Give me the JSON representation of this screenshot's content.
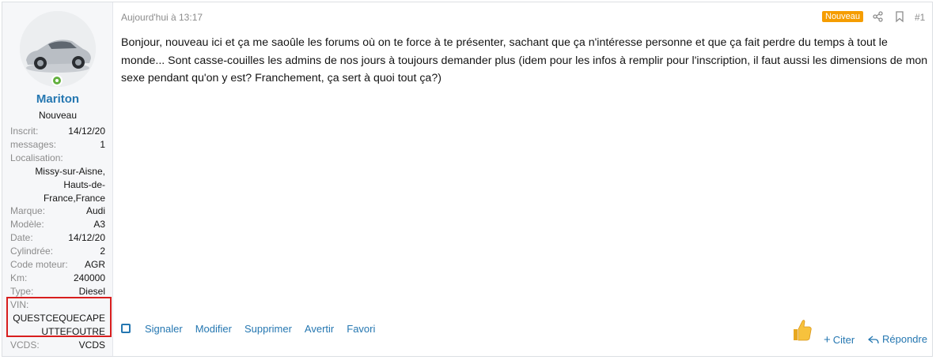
{
  "user": {
    "name": "Mariton",
    "title": "Nouveau",
    "fields": [
      {
        "k": "Inscrit:",
        "v": "14/12/20"
      },
      {
        "k": "messages:",
        "v": "1"
      }
    ],
    "location_label": "Localisation:",
    "location_lines": [
      "Missy-sur-Aisne,",
      "Hauts-de-",
      "France,France"
    ],
    "fields2": [
      {
        "k": "Marque:",
        "v": "Audi"
      },
      {
        "k": "Modèle:",
        "v": "A3"
      },
      {
        "k": "Date:",
        "v": "14/12/20"
      },
      {
        "k": "Cylindrée:",
        "v": "2"
      },
      {
        "k": "Code moteur:",
        "v": "AGR"
      },
      {
        "k": "Km:",
        "v": "240000"
      },
      {
        "k": "Type:",
        "v": "Diesel"
      }
    ],
    "vin_label": "VIN:",
    "vin_lines": [
      "QUESTCEQUECAPE",
      "UTTEFOUTRE"
    ],
    "vcds_label": "VCDS:",
    "vcds_value": "VCDS"
  },
  "post": {
    "date": "Aujourd'hui à 13:17",
    "badge": "Nouveau",
    "number": "#1",
    "body": "Bonjour, nouveau ici et ça me saoûle les forums où on te force à te présenter, sachant que ça n'intéresse personne et que ça fait perdre du temps à tout le monde... Sont casse-couilles les admins de nos jours à toujours demander plus (idem pour les infos à remplir pour l'inscription, il faut aussi les dimensions de mon sexe pendant qu'on y est? Franchement, ça sert à quoi tout ça?)"
  },
  "actions": {
    "report": "Signaler",
    "edit": "Modifier",
    "delete": "Supprimer",
    "warn": "Avertir",
    "fav": "Favori",
    "quote": "Citer",
    "reply": "Répondre"
  },
  "colors": {
    "link": "#2577b1",
    "badge": "#f59d00",
    "highlight_box": "#d81e1e",
    "online": "#63b03f"
  }
}
